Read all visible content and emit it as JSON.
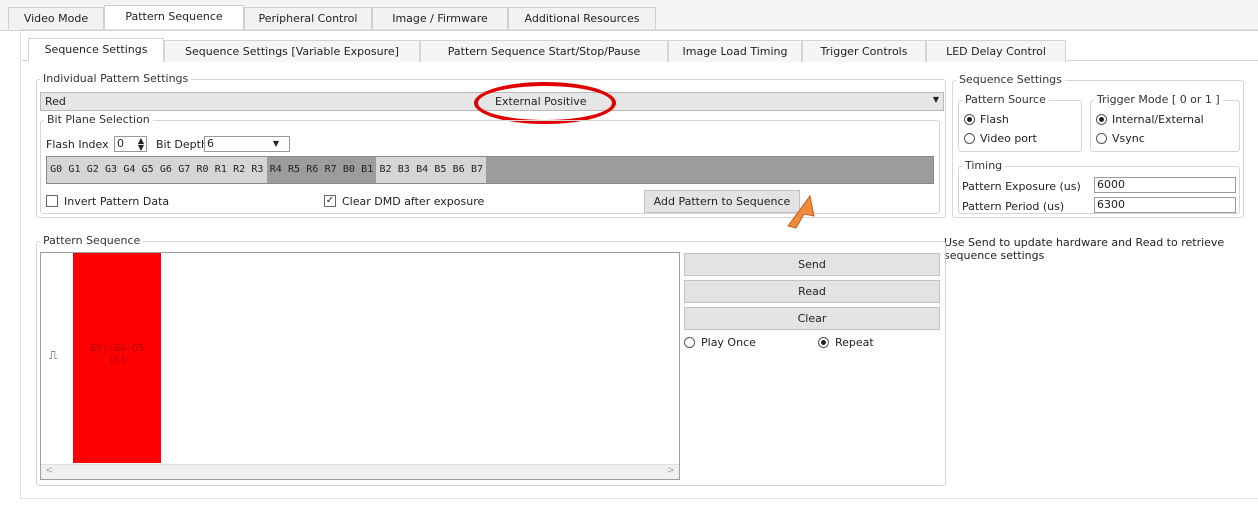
{
  "top_tabs": [
    "Video Mode",
    "Pattern Sequence",
    "Peripheral Control",
    "Image / Firmware",
    "Additional Resources"
  ],
  "inner_tabs": [
    "Sequence Settings",
    "Sequence Settings [Variable Exposure]",
    "Pattern Sequence Start/Stop/Pause",
    "Image Load Timing",
    "Trigger Controls",
    "LED Delay Control"
  ],
  "individual": {
    "group_label": "Individual Pattern Settings",
    "color_value": "Red",
    "trigger_value": "External Positive",
    "bitplane_label": "Bit Plane Selection",
    "flash_index_label": "Flash Index",
    "flash_index_value": "0",
    "bit_depth_label": "Bit Depth",
    "bit_depth_value": "6",
    "bits": [
      "G0",
      "G1",
      "G2",
      "G3",
      "G4",
      "G5",
      "G6",
      "G7",
      "R0",
      "R1",
      "R2",
      "R3",
      "R4",
      "R5",
      "R6",
      "R7",
      "B0",
      "B1",
      "B2",
      "B3",
      "B4",
      "B5",
      "B6",
      "B7"
    ],
    "invert_label": "Invert Pattern Data",
    "invert_checked": false,
    "clear_label": "Clear DMD after exposure",
    "clear_checked": true,
    "add_button": "Add Pattern to Sequence"
  },
  "sequence_settings": {
    "group_label": "Sequence Settings",
    "pattern_source_label": "Pattern Source",
    "source_flash": "Flash",
    "source_video": "Video port",
    "trigger_mode_label": "Trigger Mode [ 0 or 1 ]",
    "trigger_internal": "Internal/External",
    "trigger_vsync": "Vsync",
    "timing_label": "Timing",
    "exposure_label": "Pattern Exposure (us)",
    "exposure_value": "6000",
    "period_label": "Pattern Period (us)",
    "period_value": "6300"
  },
  "help_text": "Use Send to update hardware and Read to retrieve sequence settings",
  "pattern_sequence": {
    "group_label": "Pattern Sequence",
    "trigger_glyph": "⎍",
    "pattern_label_line1": "80::G0-G5",
    "pattern_label_line2": "(6)",
    "pattern_color": "#ff0000"
  },
  "buttons": {
    "send": "Send",
    "read": "Read",
    "clear": "Clear"
  },
  "play_once": "Play Once",
  "repeat": "Repeat",
  "colors": {
    "highlight_circle": "#e00000",
    "cursor": "#f08a3c"
  }
}
